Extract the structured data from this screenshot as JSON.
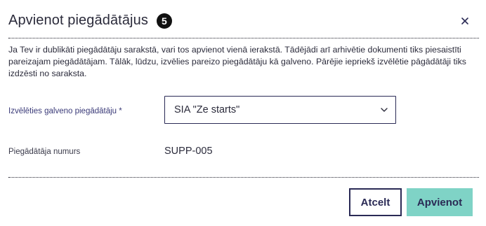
{
  "dialog": {
    "title": "Apvienot piegādātājus",
    "count": "5",
    "description": "Ja Tev ir dublikāti piegādātāju sarakstā, vari tos apvienot vienā ierakstā. Tādējādi arī arhivētie dokumenti tiks piesaistīti pareizajam piegādātājam. Tālāk, lūdzu, izvēlies pareizo piegādātāju kā galveno. Pārējie iepriekš izvēlētie pāgādātāji tiks izdzēsti no saraksta.",
    "primary_supplier": {
      "label": "Izvēlēties galveno piegādātāju *",
      "selected": "SIA \"Ze starts\""
    },
    "supplier_number": {
      "label": "Piegādātāja numurs",
      "value": "SUPP-005"
    },
    "buttons": {
      "cancel": "Atcelt",
      "merge": "Apvienot"
    }
  },
  "colors": {
    "primary_navy": "#2a2a55",
    "accent_teal": "#7fd3c6",
    "badge_black": "#111111"
  },
  "icons": {
    "close": "close-icon",
    "dropdown": "chevron-down-icon"
  }
}
